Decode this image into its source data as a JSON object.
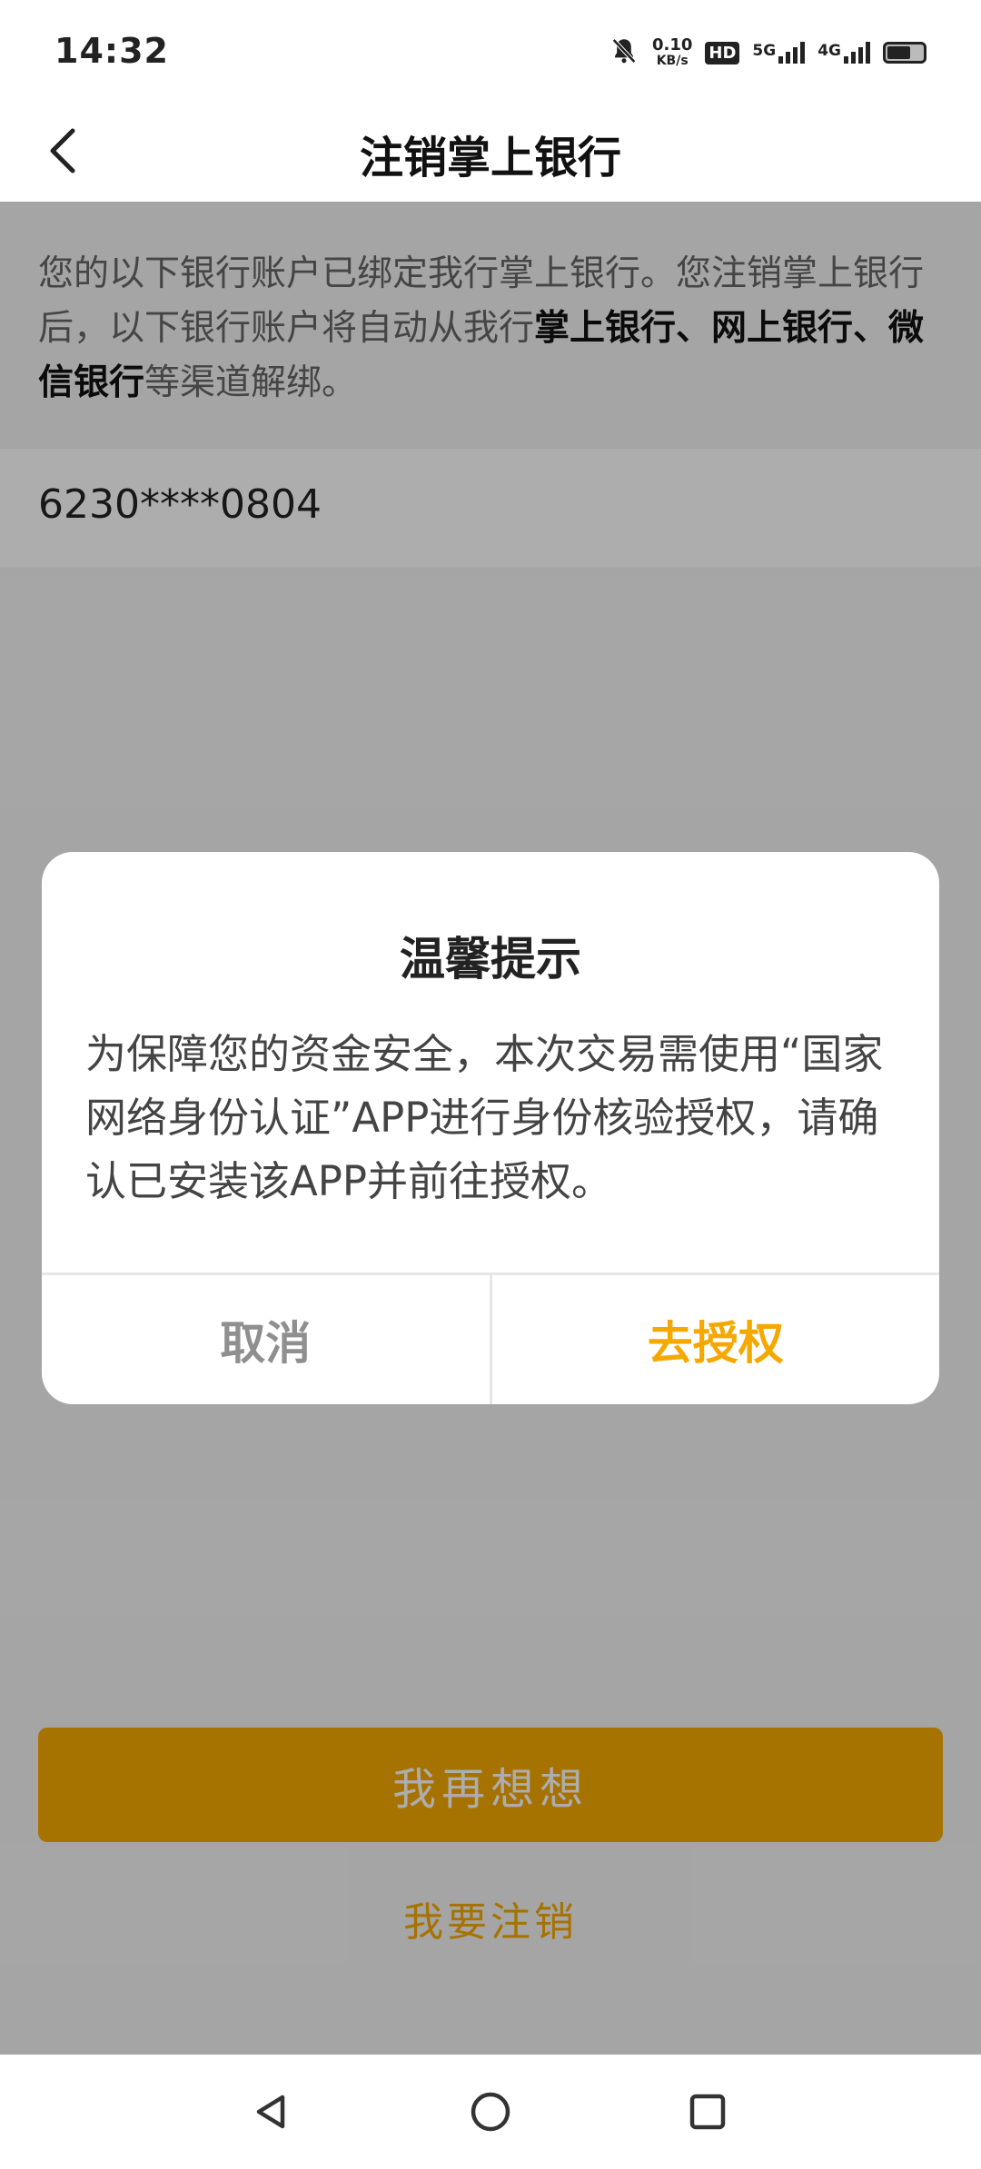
{
  "status_bar": {
    "time": "14:32",
    "speed_value": "0.10",
    "speed_unit": "KB/s",
    "hd_label": "HD",
    "sim1_network": "5G",
    "sim2_network": "4G"
  },
  "nav": {
    "title": "注销掌上银行"
  },
  "notice": {
    "text_part1": "您的以下银行账户已绑定我行掌上银行。您注销掌上银行后，以下银行账户将自动从我行",
    "text_bold": "掌上银行、网上银行、微信银行",
    "text_part2": "等渠道解绑。"
  },
  "account": {
    "number": "6230****0804"
  },
  "actions": {
    "think_again_label": "我再想想",
    "cancel_account_label": "我要注销"
  },
  "dialog": {
    "title": "温馨提示",
    "message": "为保障您的资金安全，本次交易需使用“国家网络身份认证”APP进行身份核验授权，请确认已安装该APP并前往授权。",
    "cancel_label": "取消",
    "confirm_label": "去授权"
  },
  "colors": {
    "accent": "#f5a800",
    "overlay": "rgba(0,0,0,0.32)"
  },
  "icons": {
    "back": "chevron-left-icon",
    "mute": "bell-off-icon",
    "sys_back": "triangle-back-icon",
    "sys_home": "circle-home-icon",
    "sys_recent": "square-recent-icon"
  }
}
